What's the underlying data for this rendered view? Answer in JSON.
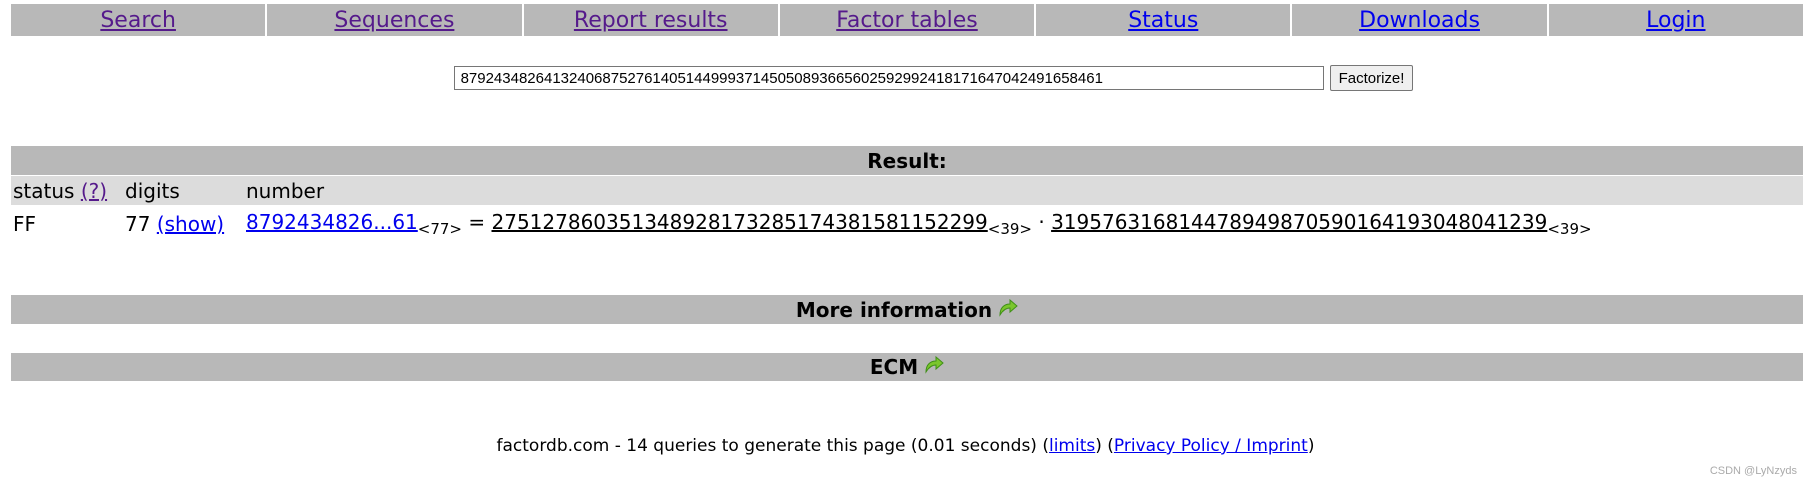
{
  "nav": {
    "items": [
      {
        "label": "Search"
      },
      {
        "label": "Sequences"
      },
      {
        "label": "Report results"
      },
      {
        "label": "Factor tables"
      },
      {
        "label": "Status"
      },
      {
        "label": "Downloads"
      },
      {
        "label": "Login"
      }
    ]
  },
  "search": {
    "value": "87924348264132406875276140514499937145050893665602592992418171647042491658461",
    "button_label": "Factorize!"
  },
  "result": {
    "title": "Result:",
    "headers": {
      "status": "status",
      "status_help": "(?)",
      "digits": "digits",
      "number": "number"
    },
    "row": {
      "status": "FF",
      "digits": "77",
      "show": "(show)",
      "number_short": "8792434826...61",
      "number_len": "<77>",
      "equals": "=",
      "factor1": "275127860351348928173285174381581152299",
      "factor1_len": "<39>",
      "dot": "·",
      "factor2": "319576316814478949870590164193048041239",
      "factor2_len": "<39>"
    }
  },
  "sections": {
    "more_info": "More information",
    "ecm": "ECM"
  },
  "footer": {
    "text": "factordb.com - 14 queries to generate this page (0.01 seconds) ",
    "limits": "limits",
    "privacy": "Privacy Policy / Imprint"
  },
  "watermark": "CSDN @LyNzyds",
  "colors": {
    "bar": "#b8b8b8",
    "header_row": "#dcdcdc",
    "link": "#0000ee",
    "visited": "#551a8b",
    "arrow": "#7bc62d"
  }
}
